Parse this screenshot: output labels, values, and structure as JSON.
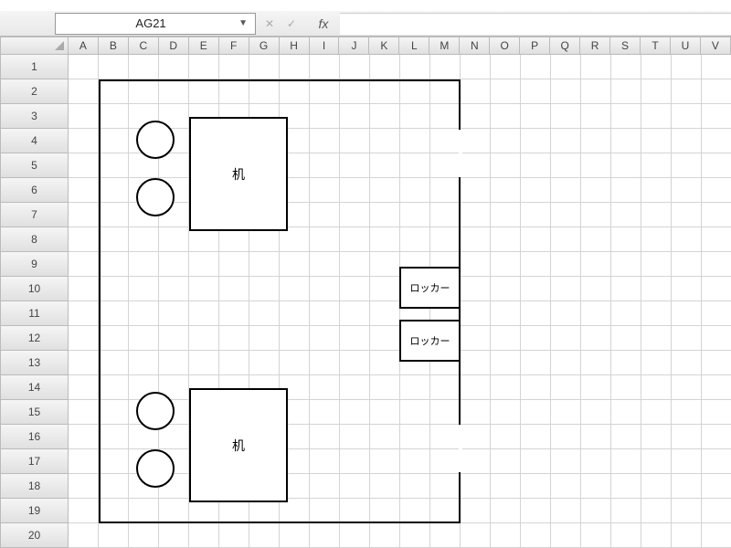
{
  "nameBox": "AG21",
  "columns": [
    "A",
    "B",
    "C",
    "D",
    "E",
    "F",
    "G",
    "H",
    "I",
    "J",
    "K",
    "L",
    "M",
    "N",
    "O",
    "P",
    "Q",
    "R",
    "S",
    "T",
    "U",
    "V"
  ],
  "rows": [
    "1",
    "2",
    "3",
    "4",
    "5",
    "6",
    "7",
    "8",
    "9",
    "10",
    "11",
    "12",
    "13",
    "14",
    "15",
    "16",
    "17",
    "18",
    "19",
    "20"
  ],
  "shapes": {
    "desk1_label": "机",
    "desk2_label": "机",
    "locker1_label": "ロッカー",
    "locker2_label": "ロッカー"
  },
  "fx_label": "fx"
}
